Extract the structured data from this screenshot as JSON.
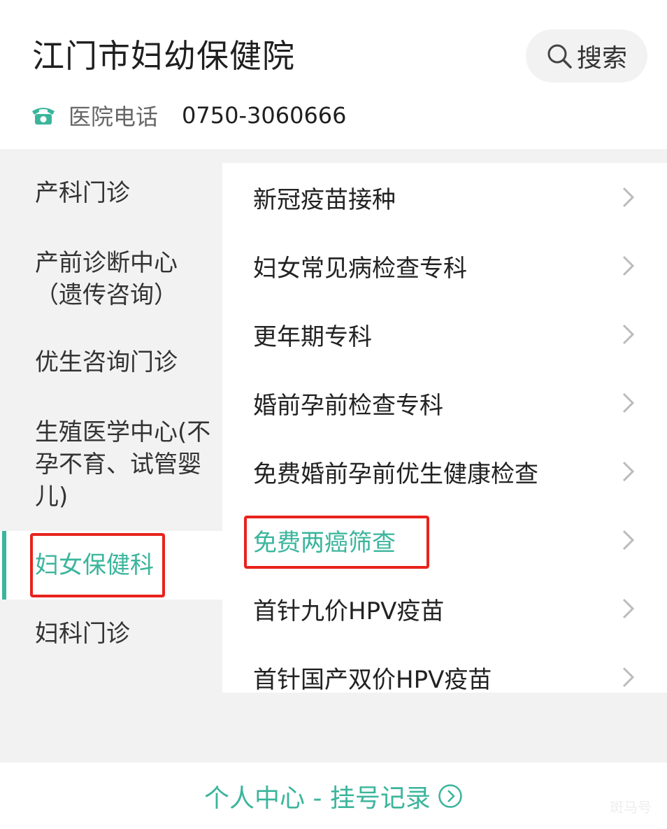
{
  "header": {
    "title": "江门市妇幼保健院",
    "search_label": "搜索",
    "phone_label": "医院电话",
    "phone_number": "0750-3060666"
  },
  "sidebar": {
    "items": [
      {
        "label": "产科门诊"
      },
      {
        "label_line1": "产前诊断中心",
        "label_line2": "（遗传咨询）"
      },
      {
        "label": "优生咨询门诊"
      },
      {
        "label_line1": "生殖医学中心(不",
        "label_line2": "孕不育、试管婴",
        "label_line3": "儿)"
      },
      {
        "label": "妇女保健科",
        "active": true
      },
      {
        "label": "妇科门诊"
      }
    ]
  },
  "content": {
    "items": [
      {
        "label": "新冠疫苗接种"
      },
      {
        "label": "妇女常见病检查专科"
      },
      {
        "label": "更年期专科"
      },
      {
        "label": "婚前孕前检查专科"
      },
      {
        "label": "免费婚前孕前优生健康检查"
      },
      {
        "label": "免费两癌筛查",
        "active": true
      },
      {
        "label": "首针九价HPV疫苗"
      },
      {
        "label": "首针国产双价HPV疫苗"
      }
    ]
  },
  "footer": {
    "link_label": "个人中心 - 挂号记录"
  },
  "watermark": "斑马号",
  "colors": {
    "accent": "#3bb59c",
    "highlight_box": "#e8231c",
    "sidebar_bg": "#f2f2f2"
  },
  "icons": [
    "search-icon",
    "phone-icon",
    "chevron-right-icon",
    "circle-chevron-right-icon"
  ]
}
